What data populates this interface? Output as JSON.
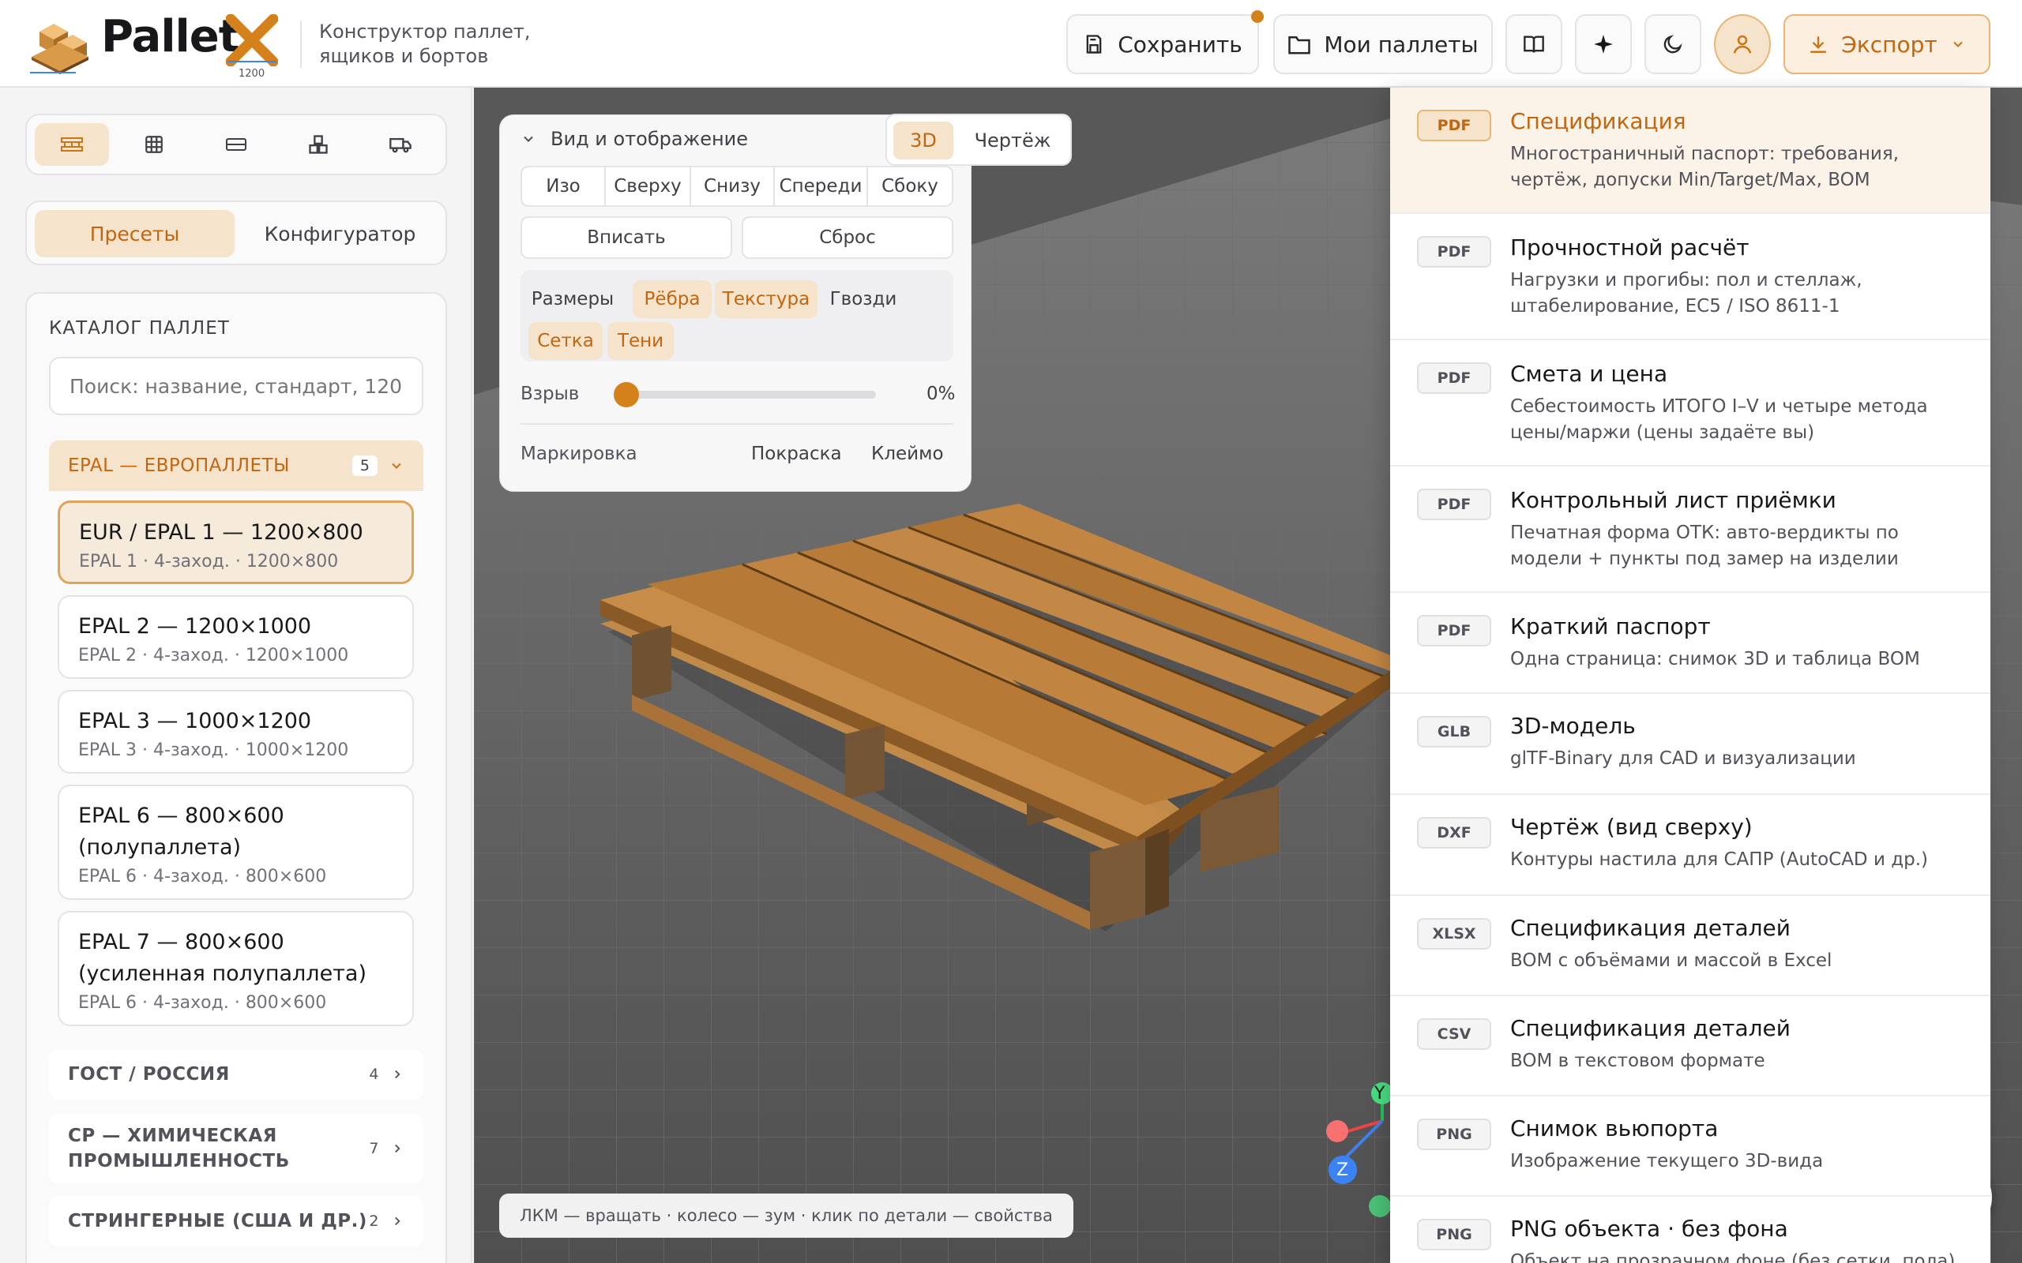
{
  "app": {
    "brand": "Pallet",
    "logo_number": "1200",
    "subtitle_line1": "Конструктор паллет,",
    "subtitle_line2": "ящиков и бортов"
  },
  "header": {
    "save_label": "Сохранить",
    "my_pallets_label": "Мои паллеты",
    "export_label": "Экспорт"
  },
  "sidebar": {
    "tabs": [
      {
        "icon": "pallet-icon",
        "active": true
      },
      {
        "icon": "grid-icon",
        "active": false
      },
      {
        "icon": "board-icon",
        "active": false
      },
      {
        "icon": "boxes-icon",
        "active": false
      },
      {
        "icon": "truck-icon",
        "active": false
      }
    ],
    "mode_presets": "Пресеты",
    "mode_configurator": "Конфигуратор",
    "catalog_title": "КАТАЛОГ ПАЛЛЕТ",
    "search_placeholder": "Поиск: название, стандарт, 120",
    "epal_group": {
      "title": "EPAL — ЕВРОПАЛЛЕТЫ",
      "count": "5"
    },
    "presets": [
      {
        "title": "EUR / EPAL 1 — 1200×800",
        "sub": "EPAL 1 · 4-заход. · 1200×800",
        "selected": true
      },
      {
        "title": "EPAL 2 — 1200×1000",
        "sub": "EPAL 2 · 4-заход. · 1200×1000",
        "selected": false
      },
      {
        "title": "EPAL 3 — 1000×1200",
        "sub": "EPAL 3 · 4-заход. · 1000×1200",
        "selected": false
      },
      {
        "title": "EPAL 6 — 800×600 (полупаллета)",
        "sub": "EPAL 6 · 4-заход. · 800×600",
        "selected": false
      },
      {
        "title": "EPAL 7 — 800×600 (усиленная полупаллета)",
        "sub": "EPAL 6 · 4-заход. · 800×600",
        "selected": false
      }
    ],
    "categories": [
      {
        "title": "ГОСТ / РОССИЯ",
        "count": "4"
      },
      {
        "title": "CP — ХИМИЧЕСКАЯ ПРОМЫШЛЕННОСТЬ",
        "count": "7"
      },
      {
        "title": "СТРИНГЕРНЫЕ (США И ДР.)",
        "count": "2"
      }
    ]
  },
  "view_panel": {
    "title": "Вид и отображение",
    "mode_3d": "3D",
    "mode_drawing": "Чертёж",
    "views": [
      "Изо",
      "Сверху",
      "Снизу",
      "Спереди",
      "Сбоку"
    ],
    "fit_label": "Вписать",
    "reset_label": "Сброс",
    "toggles": [
      {
        "label": "Размеры",
        "on": false
      },
      {
        "label": "Рёбра",
        "on": true
      },
      {
        "label": "Текстура",
        "on": true
      },
      {
        "label": "Гвозди",
        "on": false
      },
      {
        "label": "Сетка",
        "on": true
      },
      {
        "label": "Тени",
        "on": true
      }
    ],
    "explode_label": "Взрыв",
    "explode_value": "0%",
    "explode_fraction": 0,
    "marking_label": "Маркировка",
    "paint_label": "Покраска",
    "stamp_label": "Клеймо"
  },
  "viewport": {
    "hint": "ЛКМ — вращать · колесо — зум · клик по детали — свойства",
    "axis_y": "Y",
    "axis_z": "Z"
  },
  "export_menu": {
    "items": [
      {
        "badge": "PDF",
        "title": "Спецификация",
        "desc": "Многостраничный паспорт: требования, чертёж, допуски Min/Target/Max, BOM",
        "highlight": true
      },
      {
        "badge": "PDF",
        "title": "Прочностной расчёт",
        "desc": "Нагрузки и прогибы: пол и стеллаж, штабелирование, EC5 / ISO 8611-1"
      },
      {
        "badge": "PDF",
        "title": "Смета и цена",
        "desc": "Себестоимость ИТОГО I–V и четыре метода цены/маржи (цены задаёте вы)"
      },
      {
        "badge": "PDF",
        "title": "Контрольный лист приёмки",
        "desc": "Печатная форма ОТК: авто-вердикты по модели + пункты под замер на изделии"
      },
      {
        "badge": "PDF",
        "title": "Краткий паспорт",
        "desc": "Одна страница: снимок 3D и таблица BOM"
      },
      {
        "badge": "GLB",
        "title": "3D-модель",
        "desc": "glTF-Binary для CAD и визуализации"
      },
      {
        "badge": "DXF",
        "title": "Чертёж (вид сверху)",
        "desc": "Контуры настила для САПР (AutoCAD и др.)"
      },
      {
        "badge": "XLSX",
        "title": "Спецификация деталей",
        "desc": "BOM с объёмами и массой в Excel"
      },
      {
        "badge": "CSV",
        "title": "Спецификация деталей",
        "desc": "BOM в текстовом формате"
      },
      {
        "badge": "PNG",
        "title": "Снимок вьюпорта",
        "desc": "Изображение текущего 3D-вида"
      },
      {
        "badge": "PNG",
        "title": "PNG объекта · без фона",
        "desc": "Объект на прозрачном фоне (без сетки, пола)"
      }
    ]
  },
  "colors": {
    "accent": "#c87616",
    "accent_bg": "#f6e3cc",
    "wood": "#b57a36"
  }
}
